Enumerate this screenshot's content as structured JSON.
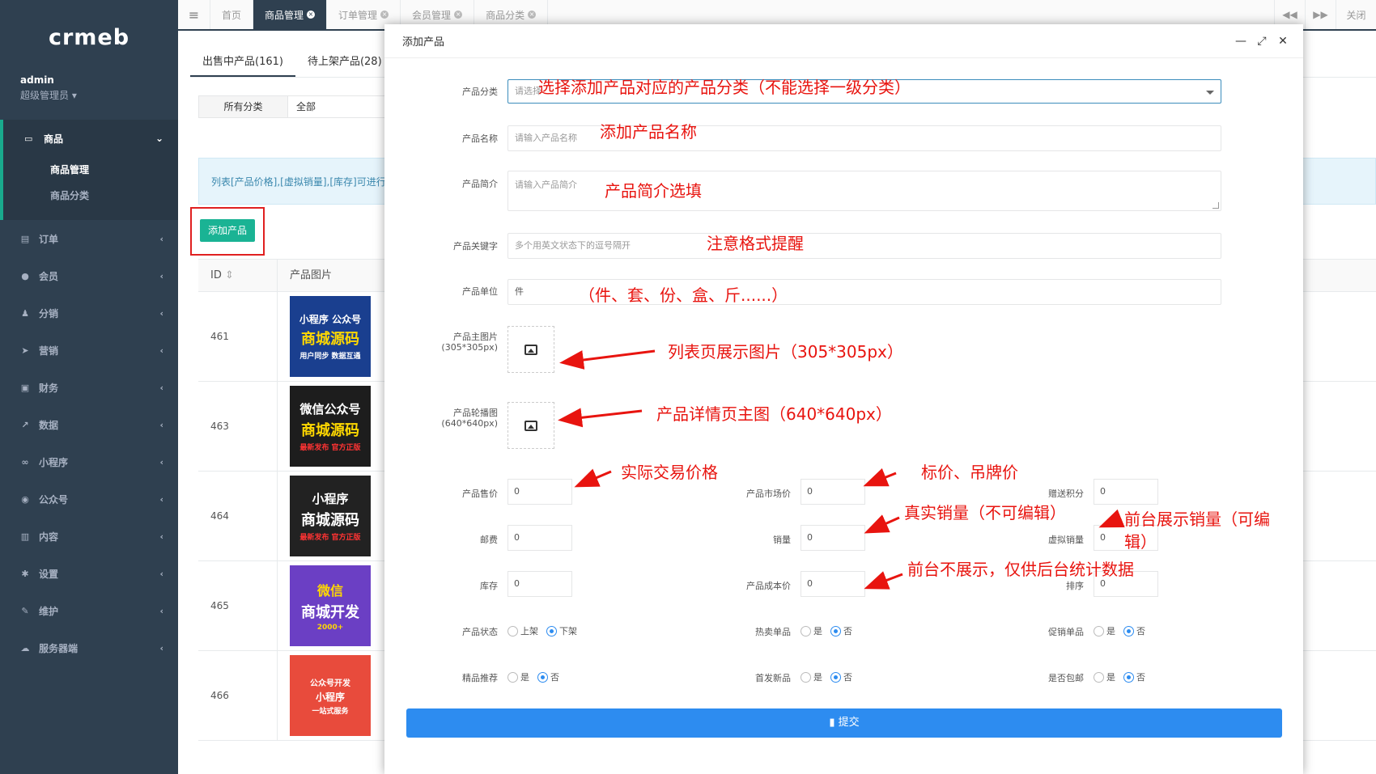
{
  "logo": "crmeb",
  "profile": {
    "name": "admin",
    "role": "超级管理员"
  },
  "nav": {
    "active": {
      "label": "商品",
      "subs": [
        "商品管理",
        "商品分类"
      ]
    },
    "items": [
      "订单",
      "会员",
      "分销",
      "营销",
      "财务",
      "数据",
      "小程序",
      "公众号",
      "内容",
      "设置",
      "维护",
      "服务器端"
    ]
  },
  "topbar": {
    "tabs": [
      {
        "label": "首页"
      },
      {
        "label": "商品管理"
      },
      {
        "label": "订单管理"
      },
      {
        "label": "会员管理"
      },
      {
        "label": "商品分类"
      }
    ],
    "close_label": "关闭"
  },
  "bg": {
    "subtabs": [
      "出售中产品(161)",
      "待上架产品(28)"
    ],
    "filter_key": "所有分类",
    "filter_val": "全部",
    "notice": "列表[产品价格],[虚拟销量],[库存]可进行",
    "add_button": "添加产品",
    "col_id": "ID",
    "col_img": "产品图片",
    "rows": [
      {
        "id": "461",
        "t1": "小程序 公众号",
        "t2": "商城源码",
        "t3": "用户同步 数据互通",
        "color": "#1a3f8f"
      },
      {
        "id": "463",
        "t1": "微信公众号",
        "t2": "商城源码",
        "t3": "最新发布 官方正版",
        "color": "#1d1d1d"
      },
      {
        "id": "464",
        "t1": "小程序",
        "t2": "商城源码",
        "t3": "最新发布 官方正版",
        "color": "#222222"
      },
      {
        "id": "465",
        "t1": "微信",
        "t2": "商城开发",
        "t3": "2000+",
        "color": "#6b3fc4"
      },
      {
        "id": "466",
        "t1": "公众号开发",
        "t2": "小程序",
        "t3": "一站式服务",
        "color": "#e84b3c"
      }
    ]
  },
  "modal": {
    "title": "添加产品",
    "labels": {
      "category": "产品分类",
      "name": "产品名称",
      "intro": "产品简介",
      "keywords": "产品关键字",
      "unit": "产品单位",
      "main_img": "产品主图片",
      "main_img_size": "(305*305px)",
      "carousel": "产品轮播图",
      "carousel_size": "(640*640px)",
      "price": "产品售价",
      "market_price": "产品市场价",
      "points": "赠送积分",
      "postage": "邮费",
      "sales": "销量",
      "virtual_sales": "虚拟销量",
      "stock": "库存",
      "cost": "产品成本价",
      "sort": "排序",
      "status": "产品状态",
      "hot": "热卖单品",
      "promo": "促销单品",
      "featured": "精品推荐",
      "new": "首发新品",
      "free_ship": "是否包邮"
    },
    "placeholders": {
      "category": "请选择",
      "name": "请输入产品名称",
      "intro": "请输入产品简介",
      "keywords": "多个用英文状态下的逗号隔开"
    },
    "values": {
      "unit": "件",
      "price": "0",
      "market_price": "0",
      "points": "0",
      "postage": "0",
      "sales": "0",
      "virtual_sales": "0",
      "stock": "0",
      "cost": "0",
      "sort": "0"
    },
    "radio": {
      "on_sale": "上架",
      "off_sale": "下架",
      "yes": "是",
      "no": "否"
    },
    "submit": "提交"
  },
  "annotations": {
    "category": "选择添加产品对应的产品分类（不能选择一级分类）",
    "name": "添加产品名称",
    "intro": "产品简介选填",
    "keywords": "注意格式提醒",
    "unit": "（件、套、份、盒、斤......）",
    "main_img": "列表页展示图片（305*305px）",
    "carousel": "产品详情页主图（640*640px）",
    "price": "实际交易价格",
    "market_price": "标价、吊牌价",
    "sales": "真实销量（不可编辑）",
    "virtual_sales_1": "前台展示销量（可编",
    "virtual_sales_2": "辑）",
    "cost": "前台不展示，仅供后台统计数据"
  },
  "colors": {
    "sidebar": "#2f4050",
    "accent": "#1ab394",
    "primary": "#2d8cf0",
    "annotation": "#e8140f"
  }
}
